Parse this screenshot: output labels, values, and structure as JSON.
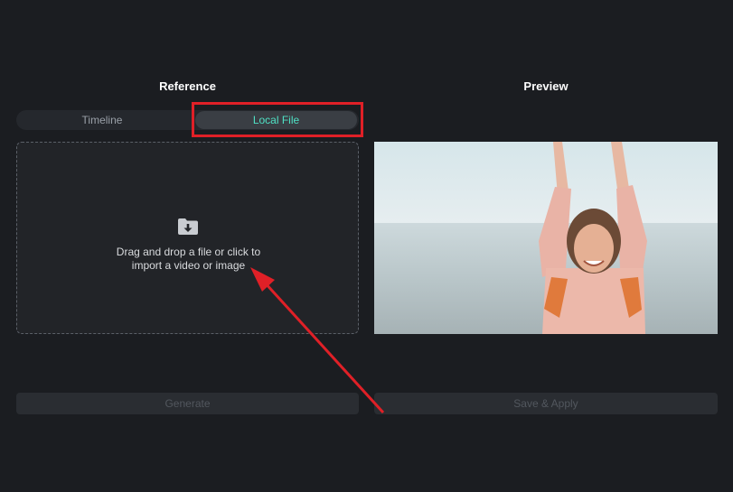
{
  "reference": {
    "title": "Reference"
  },
  "preview": {
    "title": "Preview"
  },
  "source_tabs": [
    {
      "label": "Timeline",
      "selected": false
    },
    {
      "label": "Local File",
      "selected": true
    }
  ],
  "dropzone": {
    "line1": "Drag and drop a file or click to",
    "line2": "import a video or image",
    "icon": "folder-download-icon"
  },
  "buttons": {
    "generate": "Generate",
    "save_apply": "Save & Apply"
  },
  "colors": {
    "background": "#1b1d21",
    "accent": "#4fe0c4",
    "annotation": "#e02027"
  }
}
